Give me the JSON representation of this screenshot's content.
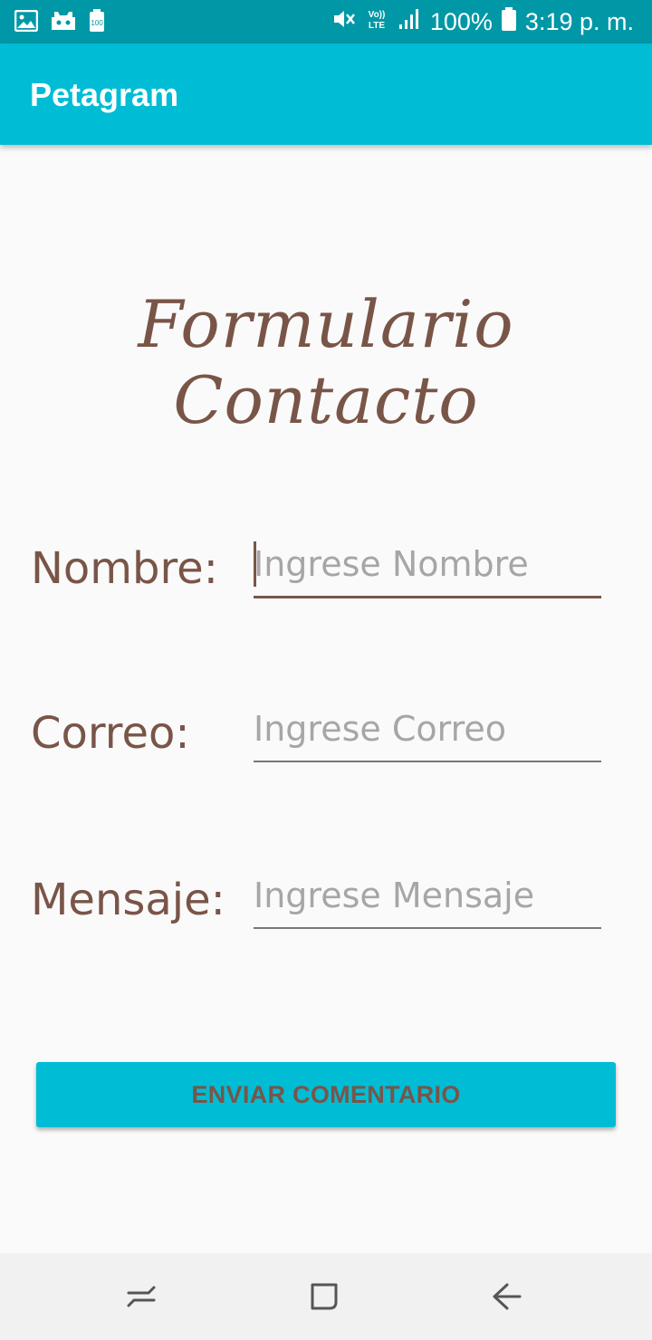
{
  "status_bar": {
    "left_icons": [
      "gallery-icon",
      "game-icon",
      "battery-saver-icon"
    ],
    "right_icons": [
      "mute-icon",
      "volte-icon",
      "signal-icon",
      "battery-icon"
    ],
    "battery_text": "100%",
    "time": "3:19 p. m."
  },
  "app_bar": {
    "title": "Petagram"
  },
  "form": {
    "title": "Formulario Contacto",
    "fields": [
      {
        "label": "Nombre:",
        "placeholder": "Ingrese Nombre"
      },
      {
        "label": "Correo:",
        "placeholder": "Ingrese Correo"
      },
      {
        "label": "Mensaje:",
        "placeholder": "Ingrese Mensaje"
      }
    ],
    "submit_label": "ENVIAR COMENTARIO"
  },
  "nav_bar": {
    "buttons": [
      "recents-icon",
      "home-icon",
      "back-icon"
    ]
  },
  "colors": {
    "primary": "#00bcd4",
    "status_bar": "#0098a6",
    "accent_brown": "#795548",
    "background": "#fafafa"
  }
}
